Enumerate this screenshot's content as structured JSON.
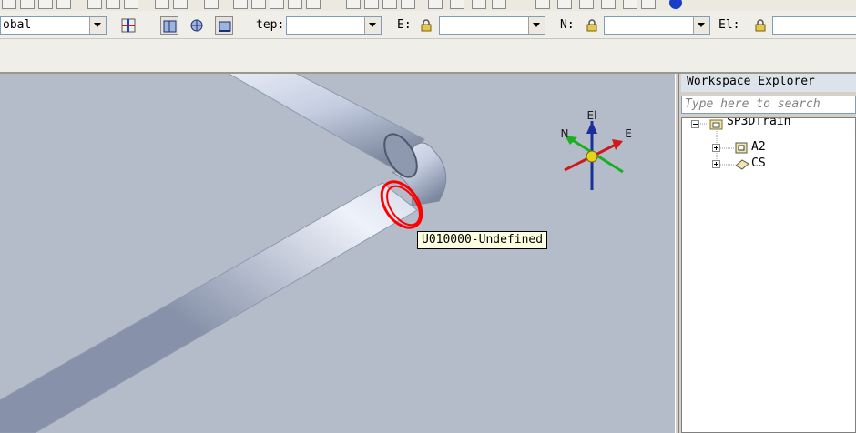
{
  "toolbar": {
    "coordinate_system": "obal",
    "step_label": "tep:",
    "step_value": "",
    "east_label": "E:",
    "east_value": "",
    "north_label": "N:",
    "north_value": "",
    "elevation_label": "El:",
    "elevation_value": ""
  },
  "viewport": {
    "tooltip": "U010000-Undefined",
    "axis_labels": {
      "elevation": "El",
      "north": "N",
      "east": "E"
    },
    "colors": {
      "background": "#b4bcca",
      "pipe": "#c7d1e4",
      "highlight": "#ff0000"
    }
  },
  "explorer": {
    "title": "Workspace Explorer",
    "search_placeholder": "Type here to search",
    "tree": [
      {
        "label": "SP3DTrain",
        "expanded": true
      },
      {
        "label": "A2",
        "expanded": false
      },
      {
        "label": "CS",
        "expanded": false
      }
    ]
  }
}
